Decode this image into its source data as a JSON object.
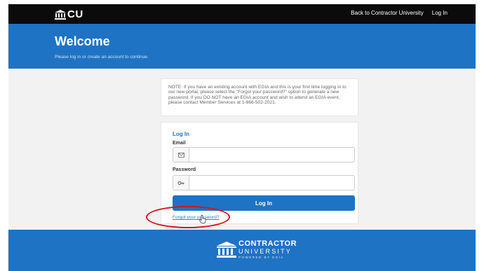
{
  "nav": {
    "logo_text": "CU",
    "links": [
      "Back to Contractor University",
      "Log In"
    ]
  },
  "hero": {
    "title": "Welcome",
    "subtitle": "Please log in or create an account to continue."
  },
  "notice": {
    "text": "NOTE: If you have an existing account with EGIA and this is your first time logging in to our new portal, please select the \"Forgot your password?\" option to generate a new password. If you DO NOT have an EGIA account and wish to attend an EGIA event, please contact Member Services at 1-866-502-2021."
  },
  "login": {
    "title": "Log In",
    "email_label": "Email",
    "email_value": "",
    "password_label": "Password",
    "password_value": "",
    "button_label": "Log In",
    "forgot_link": "Forgot your password?"
  },
  "footer": {
    "brand": "CONTRACTOR",
    "brand_sub": "UNIVERSITY",
    "powered": "POWERED BY EGIA"
  },
  "colors": {
    "brand_blue": "#1f73c4",
    "nav_black": "#0b0b0b",
    "highlight_red": "#d4141e"
  }
}
